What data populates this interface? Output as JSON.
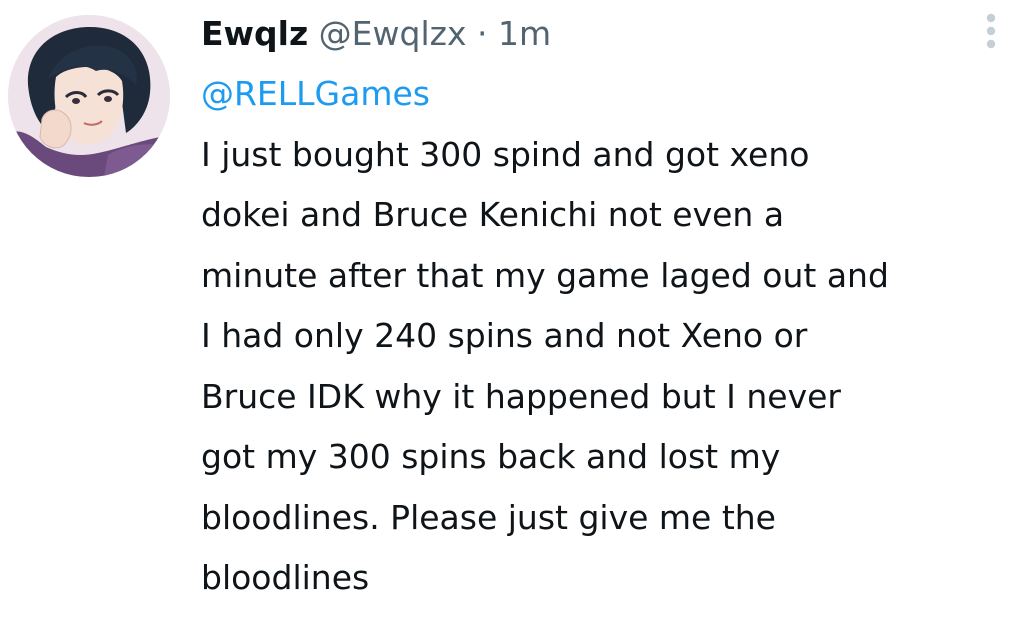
{
  "tweet": {
    "author": {
      "display_name": "Ewqlz",
      "handle": "@Ewqlzx",
      "separator": "·",
      "timestamp": "1m"
    },
    "reply_to": "@RELLGames",
    "text": "I just bought 300 spind and got xeno\ndokei and Bruce Kenichi not even a\nminute after that my game laged out and\nI had only 240 spins and not Xeno or\nBruce IDK why it happened but I never\ngot my 300 spins back and lost my\nbloodlines. Please just give me the\nbloodlines",
    "more_icon": "more-vertical-icon"
  },
  "colors": {
    "text": "#0f1419",
    "secondary": "#536471",
    "link": "#1d9bf0",
    "icon": "#c4cfd6"
  }
}
